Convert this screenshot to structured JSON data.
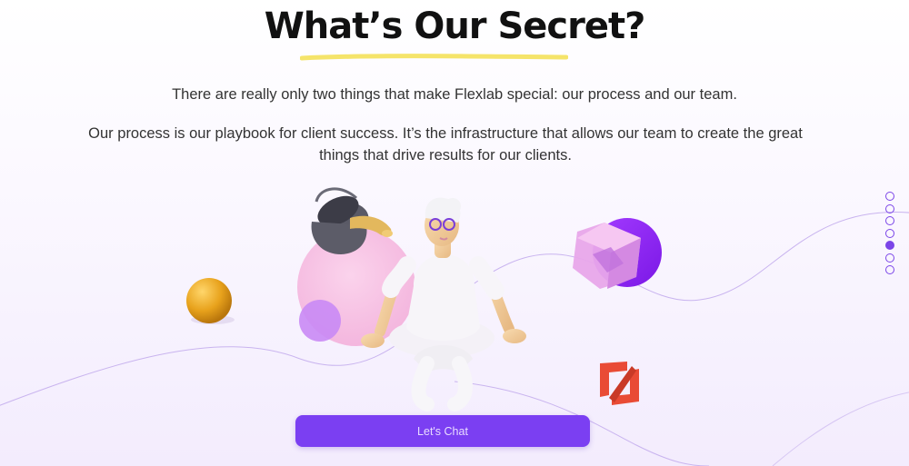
{
  "title": "What’s Our Secret?",
  "intro": "There are really only two things that make Flexlab special: our process and our team.",
  "body": "Our process is our playbook for client success. It’s the infrastructure that allows our team to create the great things that drive results for our clients.",
  "cta_label": "Let's Chat",
  "pagination": {
    "total": 7,
    "active_index": 4
  },
  "colors": {
    "accent": "#7b3ff2",
    "underline": "#f5e46a",
    "bg_tint": "#f3ecfd"
  }
}
